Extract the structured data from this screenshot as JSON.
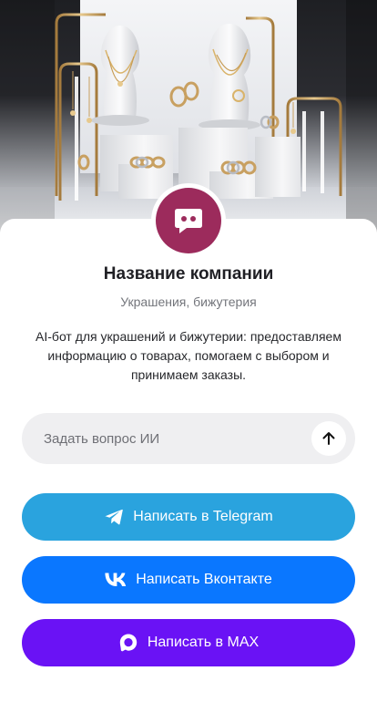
{
  "company": {
    "name": "Название компании",
    "category": "Украшения, бижутерия",
    "description": "AI-бот для украшений и бижутерии: предоставляем информацию о товарах, помогаем с выбором и принимаем заказы."
  },
  "ask": {
    "placeholder": "Задать вопрос ИИ",
    "send_icon": "arrow-up-icon"
  },
  "buttons": {
    "telegram": {
      "label": "Написать в Telegram",
      "icon": "telegram-icon",
      "color": "#2aa3de"
    },
    "vk": {
      "label": "Написать Вконтакте",
      "icon": "vk-icon",
      "color": "#0a77ff"
    },
    "max": {
      "label": "Написать в MAX",
      "icon": "max-icon",
      "color": "#6a12f5"
    }
  },
  "avatar": {
    "icon": "chat-bot-icon",
    "color": "#9c2b5c"
  }
}
